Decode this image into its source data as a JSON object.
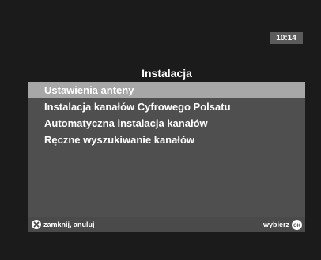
{
  "status": {
    "time": "10:14"
  },
  "header": {
    "title": "Instalacja"
  },
  "menu": {
    "items": [
      {
        "label": "Ustawienia anteny",
        "selected": true
      },
      {
        "label": "Instalacja kanałów Cyfrowego Polsatu",
        "selected": false
      },
      {
        "label": "Automatyczna instalacja kanałów",
        "selected": false
      },
      {
        "label": "Ręczne wyszukiwanie kanałów",
        "selected": false
      }
    ]
  },
  "footer": {
    "close_label": "zamknij, anuluj",
    "close_icon": "x-button-icon",
    "select_label": "wybierz",
    "select_icon": "ok-button-icon",
    "ok_glyph": "OK"
  },
  "colors": {
    "background": "#1b1b1b",
    "panel": "#4f4f4f",
    "selected_highlight": "#a7a7a7",
    "clock_box": "#5b5b5b",
    "text": "#ffffff"
  }
}
